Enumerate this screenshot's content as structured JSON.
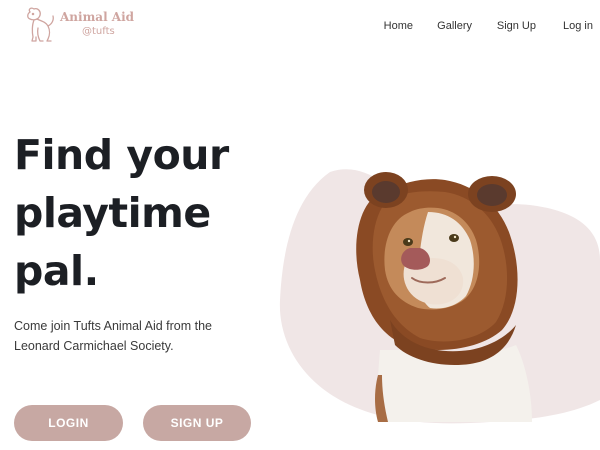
{
  "brand": {
    "title": "Animal Aid",
    "subtitle": "@tufts"
  },
  "nav": {
    "items": [
      {
        "label": "Home"
      },
      {
        "label": "Gallery"
      },
      {
        "label": "Sign Up"
      },
      {
        "label": "Log in"
      }
    ]
  },
  "hero": {
    "headline_lines": [
      "Find your",
      "playtime",
      "pal."
    ],
    "description": "Come join Tufts Animal Aid from the Leonard Carmichael Society.",
    "login_label": "LOGIN",
    "signup_label": "SIGN UP"
  },
  "colors": {
    "accent": "#c7a8a3",
    "blob": "#f0e6e6",
    "logo": "#cfa5a0"
  },
  "image": {
    "subject": "dog-in-bear-costume"
  }
}
